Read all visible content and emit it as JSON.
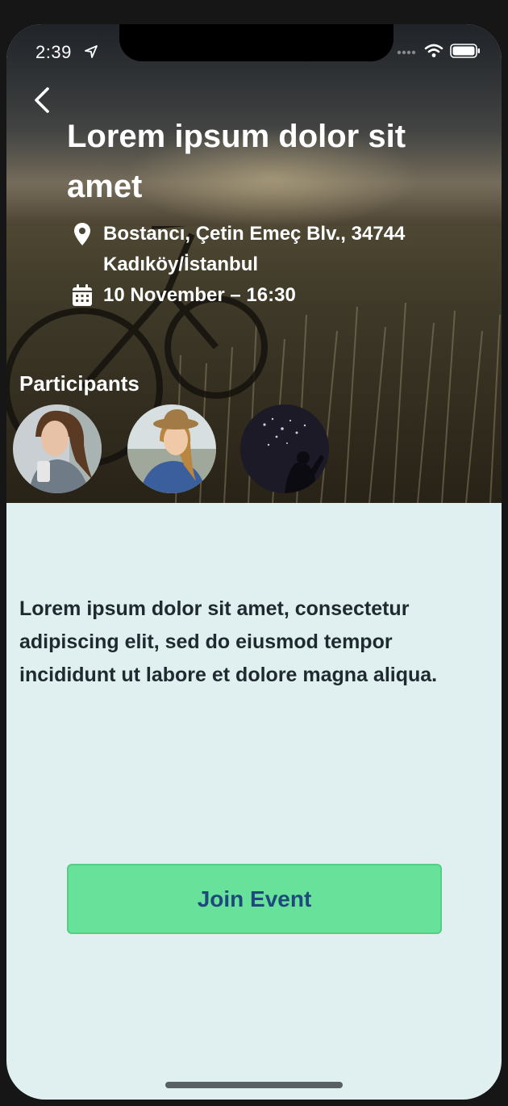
{
  "status_bar": {
    "time": "2:39",
    "icons": [
      "location-arrow-icon",
      "cellular-signal-icon",
      "wifi-icon",
      "battery-icon"
    ]
  },
  "header": {
    "back_icon": "chevron-left-icon",
    "title": "Lorem ipsum dolor sit amet",
    "location_icon": "map-pin-icon",
    "location": "Bostancı, Çetin Emeç Blv., 34744 Kadıköy/İstanbul",
    "date_icon": "calendar-icon",
    "datetime": "10 November – 16:30"
  },
  "participants": {
    "title": "Participants",
    "count": 3
  },
  "description": "Lorem ipsum dolor sit amet, consectetur adipiscing elit, sed do eiusmod tempor incididunt ut labore et dolore magna aliqua.",
  "actions": {
    "join_label": "Join Event"
  },
  "colors": {
    "background": "#e0eff0",
    "join_button": "#68e29b",
    "join_text": "#1d4a7a",
    "body_text": "#1f2a30"
  }
}
